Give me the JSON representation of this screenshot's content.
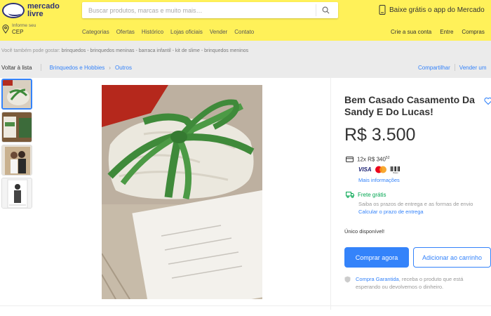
{
  "header": {
    "logo_text": "mercado livre",
    "search_placeholder": "Buscar produtos, marcas e muito mais…",
    "promo": "Baixe grátis o app do Mercado",
    "location_label": "Informe seu",
    "location_value": "CEP",
    "nav": [
      "Categorias",
      "Ofertas",
      "Histórico",
      "Lojas oficiais",
      "Vender",
      "Contato"
    ],
    "account": [
      "Crie a sua conta",
      "Entre",
      "Compras"
    ]
  },
  "suggest": {
    "label": "Você também pode gostar:",
    "items": "brinquedos - brinquedos meninas - barraca infantil - kit de slime - brinquedos meninos"
  },
  "crumbs": {
    "back": "Voltar à lista",
    "path": [
      "Brinquedos e Hobbies",
      "Outros"
    ]
  },
  "share": {
    "share": "Compartilhar",
    "sell": "Vender um"
  },
  "product": {
    "title": "Bem Casado Casamento Da Sandy E Do Lucas!",
    "price": "R$ 3.500",
    "installments": "12x R$ 340",
    "installments_cents": "52",
    "payment_brands": [
      "VISA",
      "Mastercard",
      "Boleto"
    ],
    "more_info": "Mais informações",
    "shipping_title": "Frete grátis",
    "shipping_desc": "Saiba os prazos de entrega e as formas de envio",
    "shipping_link": "Calcular o prazo de entrega",
    "stock": "Único disponível!",
    "buy_label": "Comprar agora",
    "cart_label": "Adicionar ao carrinho",
    "guarantee_link": "Compra Garantida",
    "guarantee_text": ", receba o produto que está esperando ou devolvemos o dinheiro."
  },
  "colors": {
    "header_bg": "#fff159",
    "accent": "#3483fa",
    "shipping": "#00a650",
    "brand_navy": "#2d3277"
  },
  "icons": [
    "logo-handshake",
    "search-icon",
    "phone-icon",
    "location-pin-icon",
    "card-icon",
    "truck-icon",
    "heart-icon",
    "shield-icon"
  ]
}
